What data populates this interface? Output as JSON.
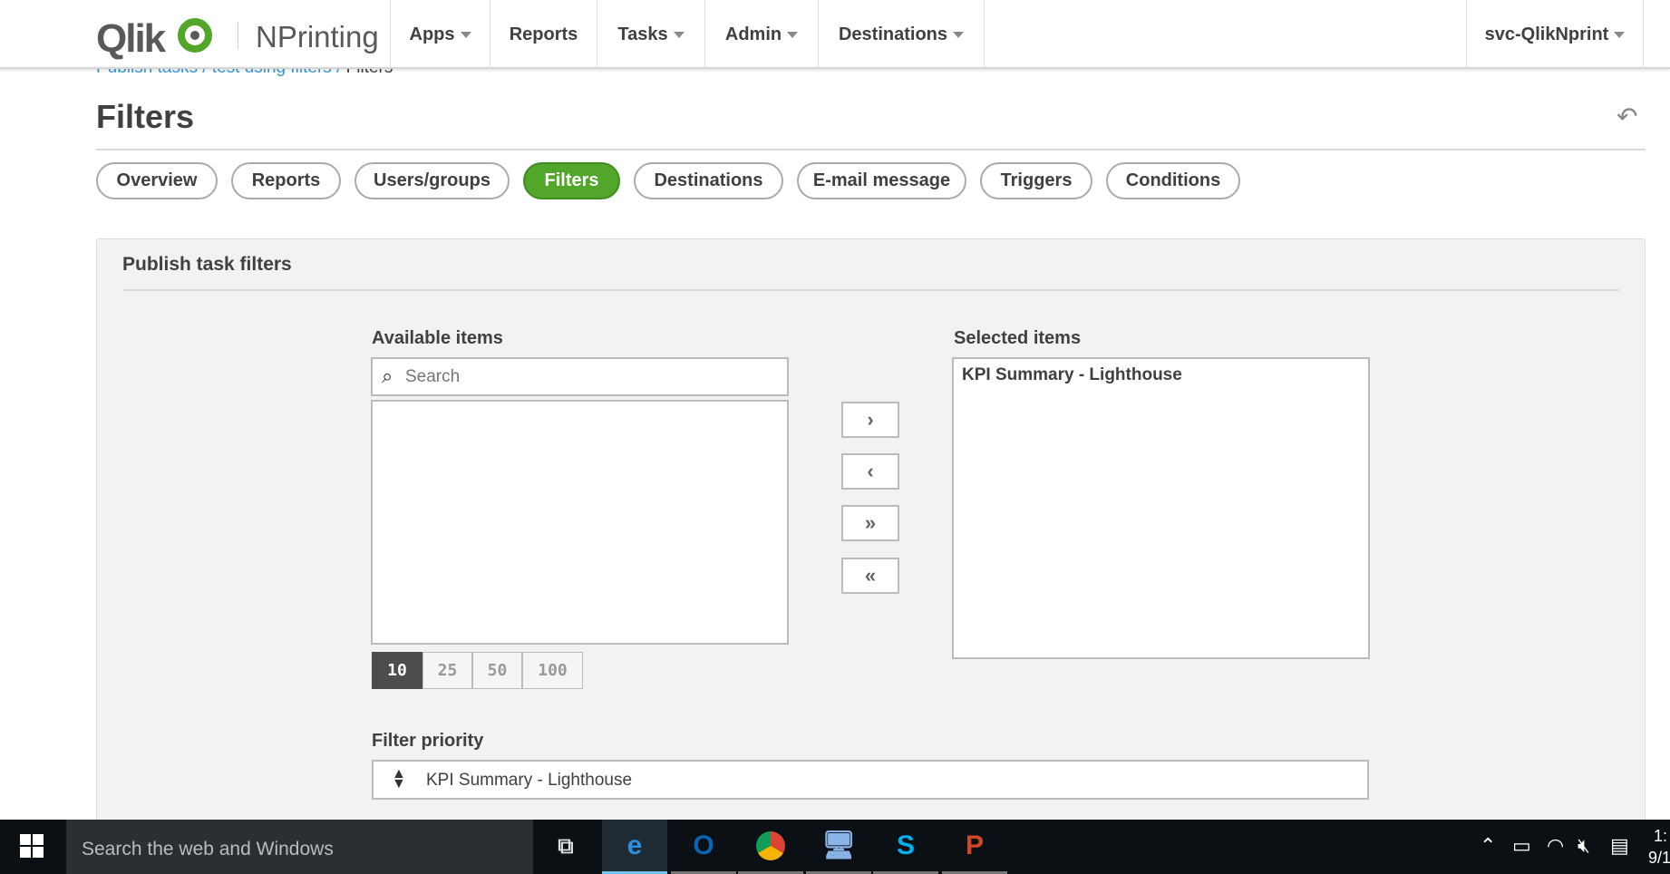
{
  "header": {
    "logo_text": "Qlik",
    "product": "NPrinting",
    "nav": [
      {
        "label": "Apps",
        "dropdown": true
      },
      {
        "label": "Reports",
        "dropdown": false
      },
      {
        "label": "Tasks",
        "dropdown": true
      },
      {
        "label": "Admin",
        "dropdown": true
      },
      {
        "label": "Destinations",
        "dropdown": true
      }
    ],
    "user": "svc-QlikNprint"
  },
  "breadcrumb": [
    "Publish tasks",
    "test using filters",
    "Filters"
  ],
  "page_title": "Filters",
  "tabs": [
    {
      "label": "Overview"
    },
    {
      "label": "Reports"
    },
    {
      "label": "Users/groups"
    },
    {
      "label": "Filters",
      "active": true
    },
    {
      "label": "Destinations"
    },
    {
      "label": "E-mail message"
    },
    {
      "label": "Triggers"
    },
    {
      "label": "Conditions"
    }
  ],
  "panel": {
    "title": "Publish task filters",
    "available": {
      "label": "Available items",
      "search_placeholder": "Search",
      "items": []
    },
    "page_sizes": [
      "10",
      "25",
      "50",
      "100"
    ],
    "page_size_selected": "10",
    "selected": {
      "label": "Selected items",
      "items": [
        "KPI Summary - Lighthouse"
      ]
    },
    "filter_priority": {
      "label": "Filter priority",
      "items": [
        "KPI Summary - Lighthouse"
      ]
    }
  },
  "taskbar": {
    "search_placeholder": "Search the web and Windows",
    "clock": "1:",
    "date": "9/1"
  },
  "colors": {
    "accent": "#52a629",
    "link": "#3a9ad9",
    "taskbar": "#0a1014"
  }
}
